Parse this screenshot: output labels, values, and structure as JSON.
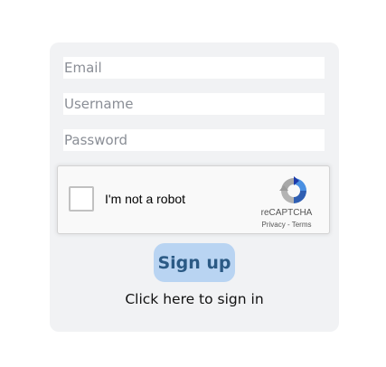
{
  "form": {
    "email_placeholder": "Email",
    "username_placeholder": "Username",
    "password_placeholder": "Password",
    "signup_label": "Sign up",
    "signin_link": "Click here to sign in"
  },
  "recaptcha": {
    "label": "I'm not a robot",
    "brand": "reCAPTCHA",
    "privacy": "Privacy",
    "separator": " - ",
    "terms": "Terms",
    "logo_icon": "recaptcha-logo-icon"
  },
  "colors": {
    "card_bg": "#f1f2f4",
    "button_bg": "#b9d4f2",
    "button_text": "#2b5a85"
  }
}
